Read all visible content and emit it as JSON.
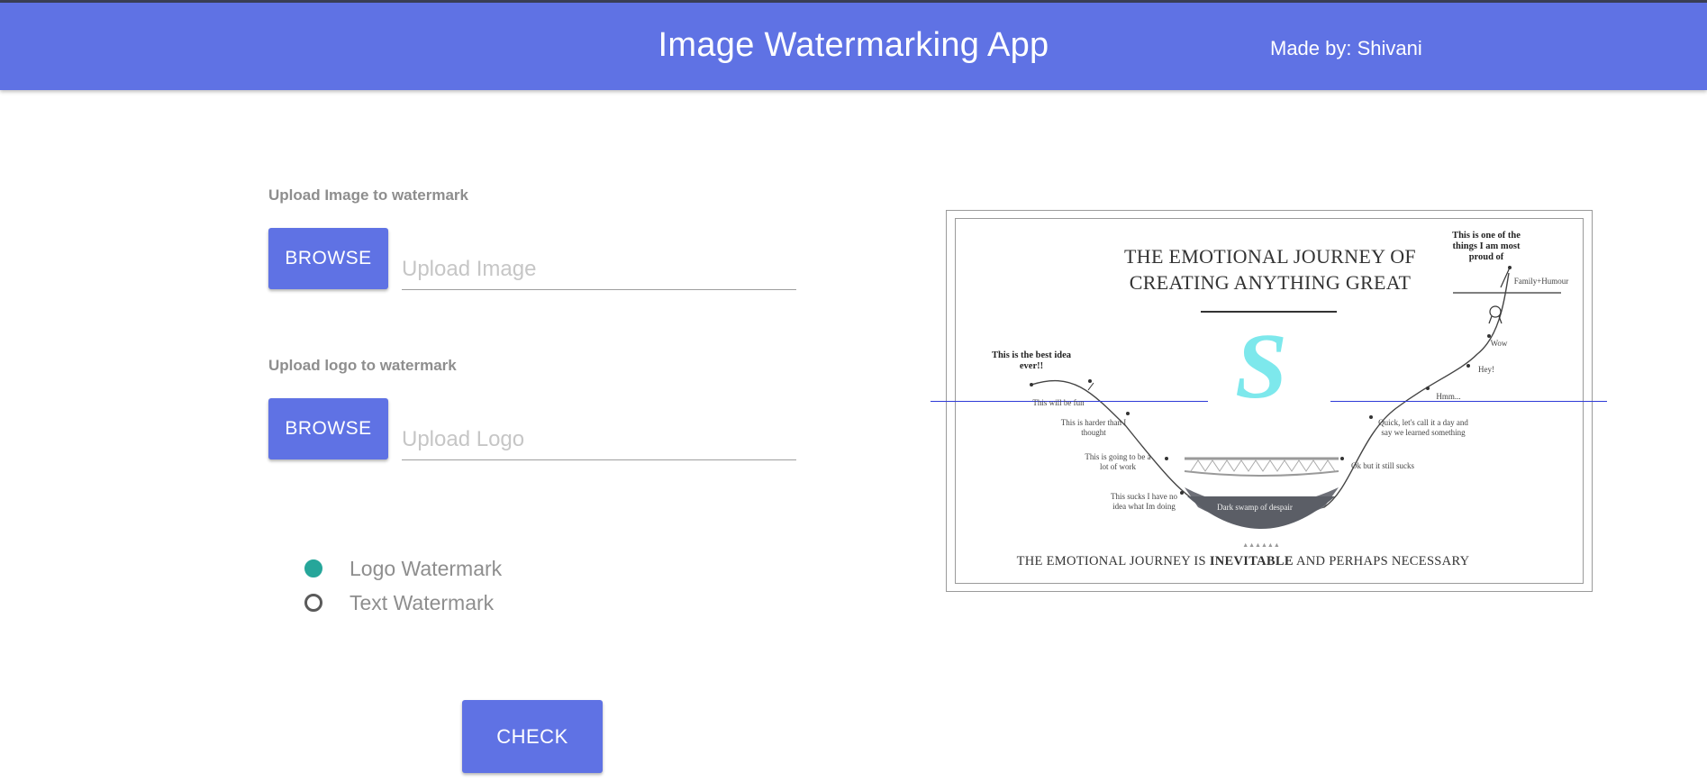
{
  "header": {
    "title": "Image Watermarking App",
    "author": "Made by: Shivani"
  },
  "image_upload": {
    "label": "Upload Image to watermark",
    "button": "BROWSE",
    "placeholder": "Upload Image"
  },
  "logo_upload": {
    "label": "Upload logo to watermark",
    "button": "BROWSE",
    "placeholder": "Upload Logo"
  },
  "watermark_type": {
    "options": [
      {
        "label": "Logo Watermark",
        "checked": true
      },
      {
        "label": "Text Watermark",
        "checked": false
      }
    ]
  },
  "check_button": "CHECK",
  "preview": {
    "title_line1": "THE EMOTIONAL JOURNEY OF",
    "title_line2": "CREATING ANYTHING GREAT",
    "footer_pre": "THE EMOTIONAL JOURNEY IS ",
    "footer_bold": "INEVITABLE",
    "footer_post": " AND PERHAPS NECESSARY",
    "watermark_letter": "S",
    "notes": {
      "best_idea": "This is the best idea ever!!",
      "fun": "This will be fun",
      "harder": "This is harder than I thought",
      "work": "This is going to be a lot of work",
      "no_idea": "This sucks I have no idea what Im doing",
      "swamp": "Dark swamp of despair",
      "still_sucks": "Ok but it still sucks",
      "quick": "Quick, let's call it a day and say we learned something",
      "hmm": "Hmm...",
      "hey": "Hey!",
      "wow": "Wow",
      "proud": "This is one of the things I am most proud of",
      "family": "Family+Humour"
    },
    "colors": {
      "watermark": "#7de8ec",
      "guide_line": "#2f3bd8",
      "swamp": "#5b5e66"
    }
  },
  "colors": {
    "primary": "#5f72e4",
    "radio_checked": "#26a69a"
  }
}
